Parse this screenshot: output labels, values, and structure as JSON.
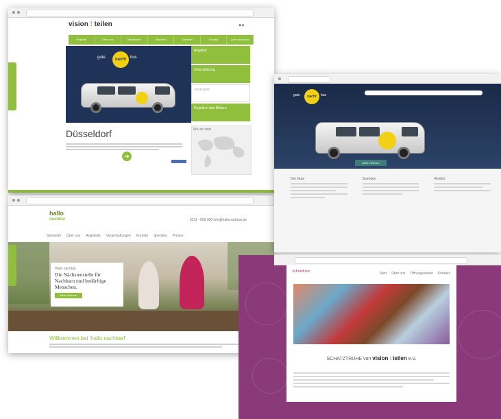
{
  "screen1": {
    "brand_left": "vision",
    "brand_right": "teilen",
    "flags": "■ ■",
    "nav": [
      "Projekte",
      "Über uns",
      "Mitmachen",
      "Aktuelles",
      "Spenden",
      "Kontakt",
      "gute nacht bus"
    ],
    "hero_logo": {
      "pre": "gute",
      "mid": "nacht",
      "post": "bus"
    },
    "side_items": [
      "Angebot",
      "Unterstützung",
      "Ehrenamt",
      "Projekt in den Bildern"
    ],
    "city": "Düsseldorf",
    "map_label": "Wo wir sind",
    "arrow": "➜",
    "colors": {
      "green": "#8fbf3d",
      "navy": "#1f3358"
    }
  },
  "screen2": {
    "logo_line1": "hallo",
    "logo_line2": "nachbar",
    "contact": "0211 - 000 000    info@hallonachbar.de",
    "menu": [
      "Startseite",
      "Über uns",
      "Angebote",
      "Veranstaltungen",
      "Kontakt",
      "Spenden",
      "Presse"
    ],
    "card_small": "Hallo nachbar",
    "card_title": "Die Nächstenstelle für Nachbarn und bedürftige Menschen.",
    "card_button": "Mehr erfahren",
    "welcome": "Willkommen bei 'hallo nachbar!'",
    "next": "›",
    "colors": {
      "green": "#8fbf3d"
    }
  },
  "screen3": {
    "hero_logo": {
      "pre": "gute",
      "mid": "nacht",
      "post": "bus"
    },
    "tag": "Mehr erfahren",
    "columns": [
      "Der Gute",
      "Spenden",
      "Anfahrt"
    ]
  },
  "screen4": {
    "logo": "Schatzkiste",
    "menu": [
      "Start",
      "Über uns",
      "Öffnungszeiten",
      "Kontakt"
    ],
    "heading_pre": "SCHATZTRUHE von",
    "heading_vision": "vision",
    "heading_teilen": "teilen",
    "heading_post": "e.V.",
    "colors": {
      "plum": "#8a3a78"
    }
  }
}
